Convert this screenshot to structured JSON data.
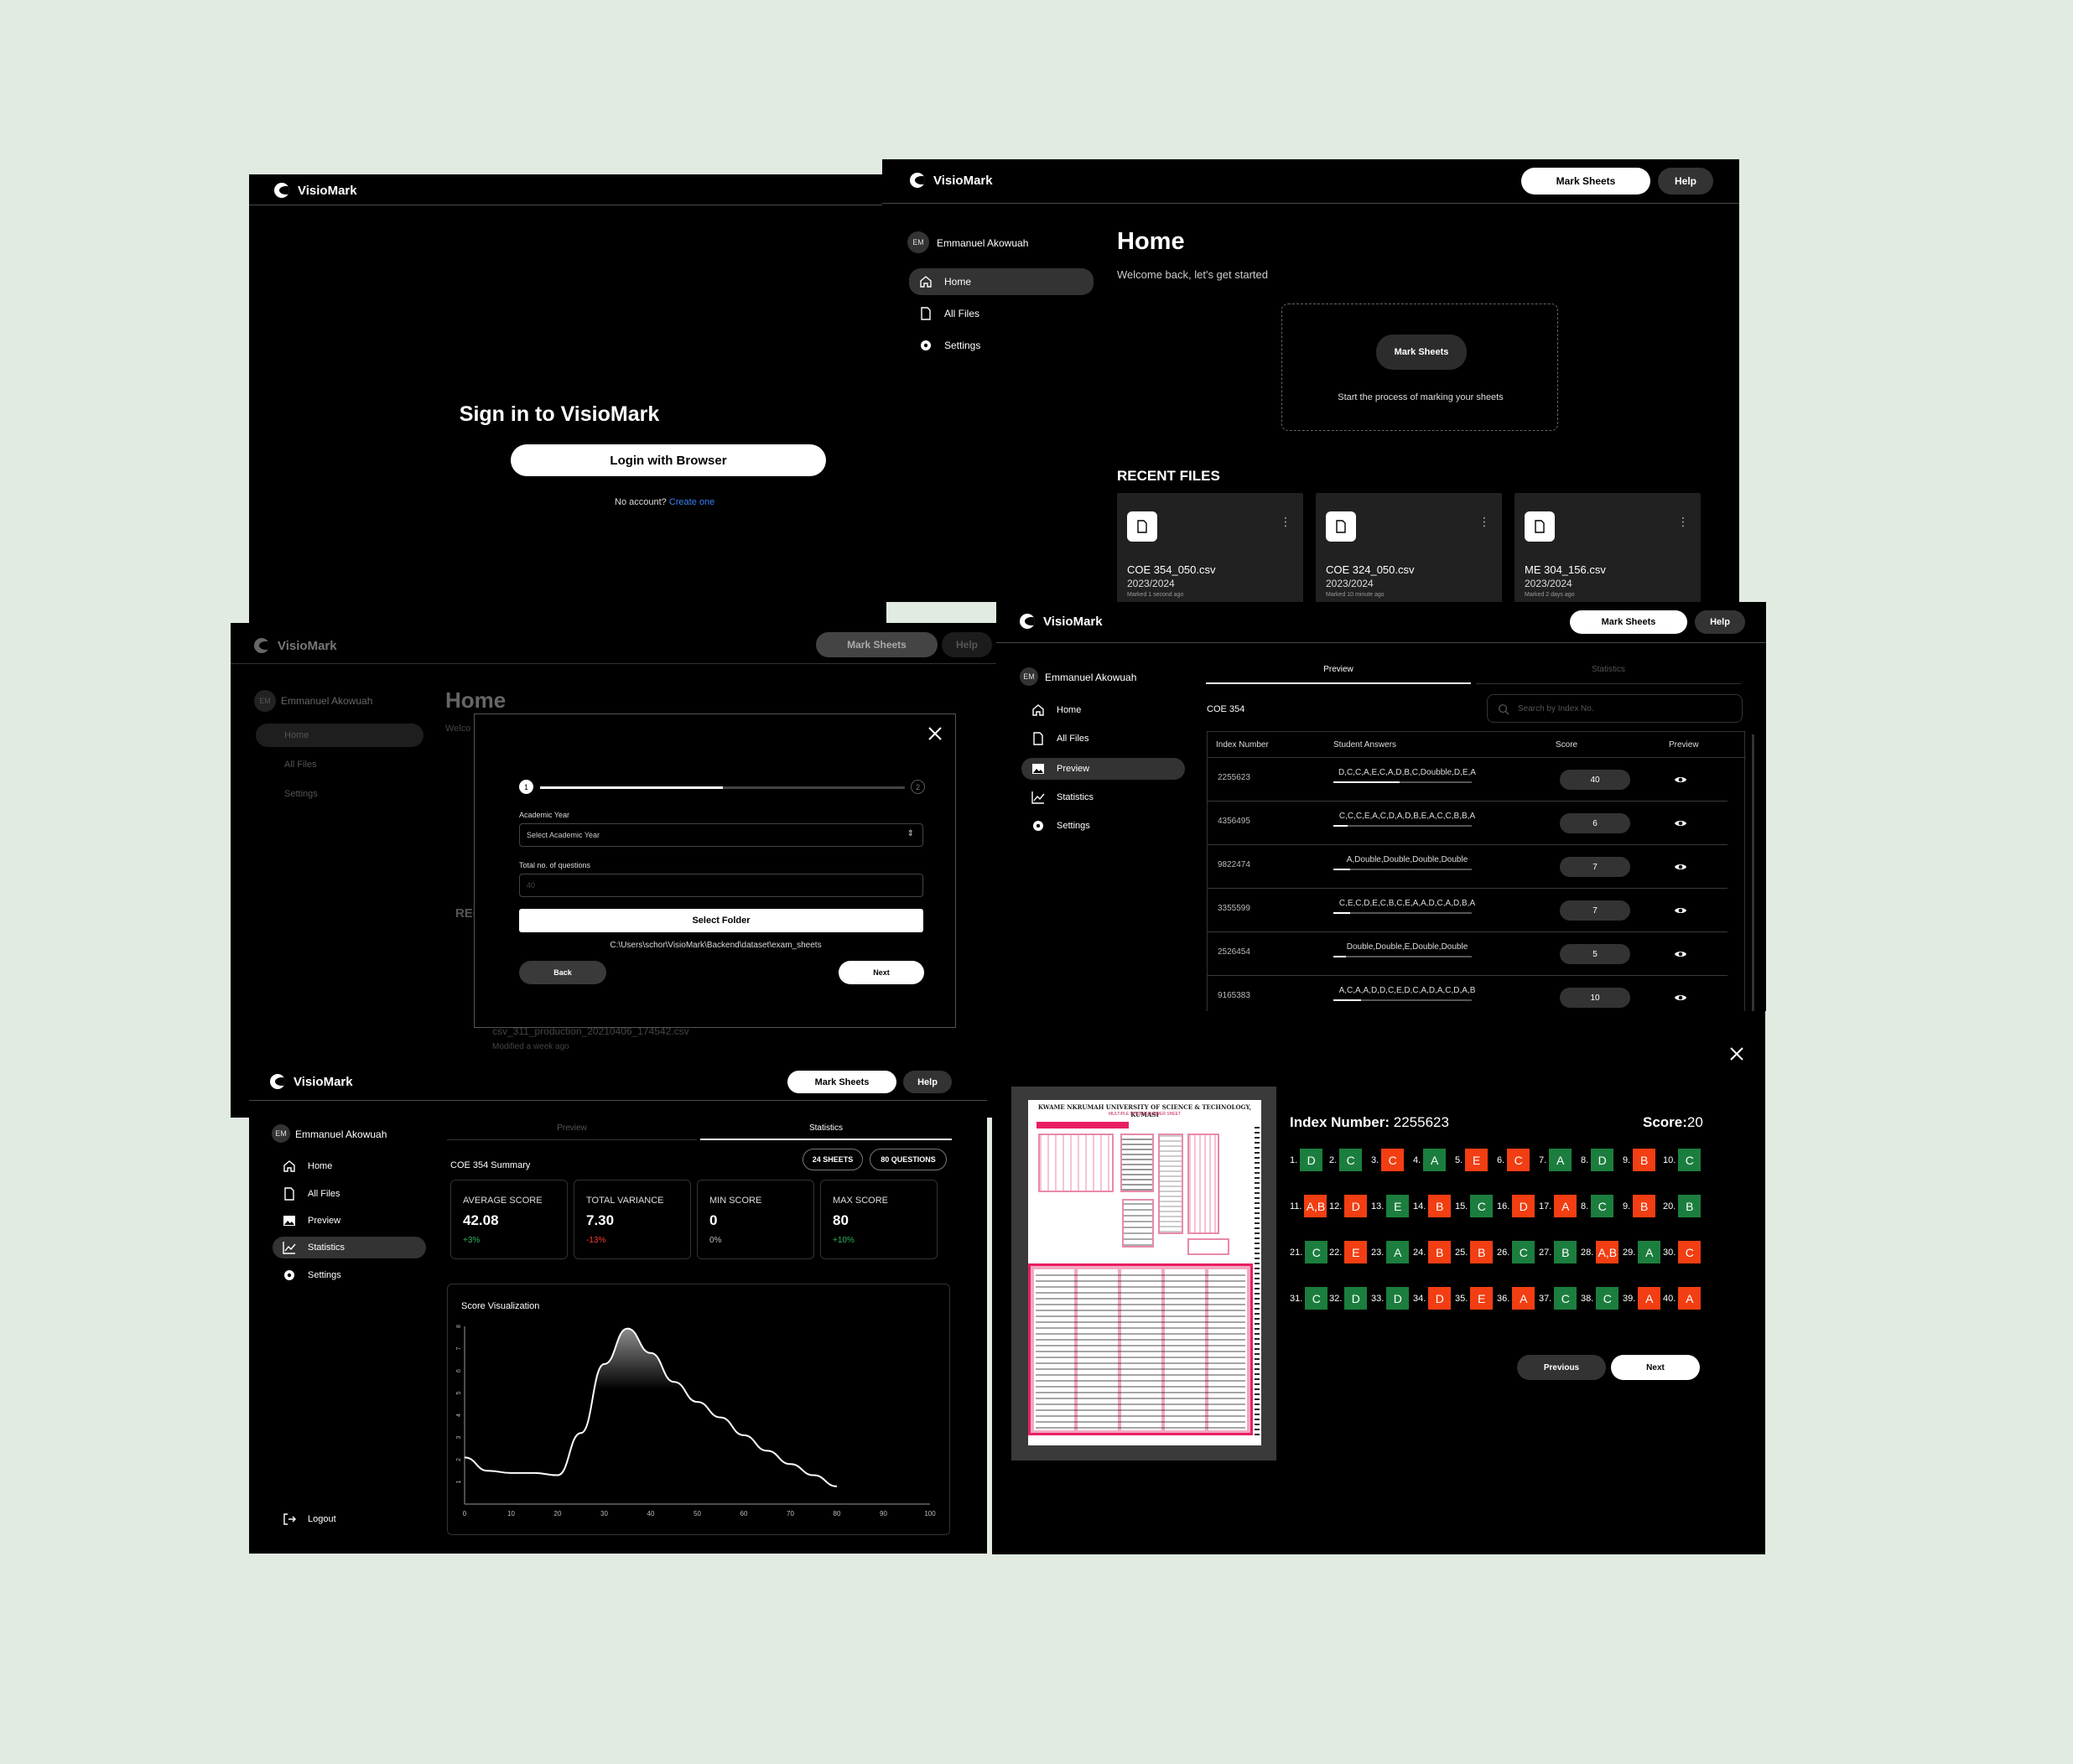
{
  "app": {
    "name": "VisioMark"
  },
  "user": {
    "initials": "EM",
    "name": "Emmanuel Akowuah"
  },
  "header": {
    "mark_sheets": "Mark Sheets",
    "help": "Help"
  },
  "nav": {
    "home": "Home",
    "all_files": "All Files",
    "settings": "Settings",
    "preview": "Preview",
    "statistics": "Statistics",
    "logout": "Logout"
  },
  "signin": {
    "title": "Sign in to VisioMark",
    "login_button": "Login with Browser",
    "no_account": "No account?",
    "create": "Create one"
  },
  "home": {
    "title": "Home",
    "subtitle": "Welcome back, let's get started",
    "cta_button": "Mark Sheets",
    "cta_text": "Start  the process of marking your sheets",
    "recent_heading": "RECENT FILES",
    "files": [
      {
        "name": "COE 354_050.csv",
        "year": "2023/2024",
        "meta": "Marked 1 second ago"
      },
      {
        "name": "COE 324_050.csv",
        "year": "2023/2024",
        "meta": "Marked 10 minute ago"
      },
      {
        "name": "ME 304_156.csv",
        "year": "2023/2024",
        "meta": "Marked 2 days ago"
      }
    ]
  },
  "modal_bg": {
    "title": "Home",
    "subtitle": "Welco",
    "recent": "REC",
    "file": "csv_311_production_20210406_174542.csv",
    "file_meta": "Modified a week ago"
  },
  "wizard": {
    "step1": "1",
    "step2": "2",
    "year_label": "Academic Year",
    "year_placeholder": "Select Academic Year",
    "questions_label": "Total no. of questions",
    "questions_placeholder": "40",
    "select_folder": "Select Folder",
    "path": "C:\\Users\\schor\\VisioMark\\Backend\\dataset\\exam_sheets",
    "back": "Back",
    "next": "Next"
  },
  "preview": {
    "tab_preview": "Preview",
    "tab_statistics": "Statistics",
    "course": "COE 354",
    "search_placeholder": "Search by Index No.",
    "columns": [
      "Index Number",
      "Student Answers",
      "Score",
      "Preview"
    ],
    "rows": [
      {
        "index": "2255623",
        "answers": "D,C,C,A,E,C,A,D,B,C,Doubble,D,E,A",
        "score": "40",
        "progress": 0.48
      },
      {
        "index": "4356495",
        "answers": "C,C,C,E,A,C,D,A,D,B,E,A,C,C,B,B,A",
        "score": "6",
        "progress": 0.1
      },
      {
        "index": "9822474",
        "answers": "A,Double,Double,Double,Double",
        "score": "7",
        "progress": 0.12
      },
      {
        "index": "3355599",
        "answers": "C,E,C,D,E,C,B,C,E,A,A,D,C,A,D,B,A",
        "score": "7",
        "progress": 0.12
      },
      {
        "index": "2526454",
        "answers": "Double,Double,E,Double,Double",
        "score": "5",
        "progress": 0.09
      },
      {
        "index": "9165383",
        "answers": "A,C,A,A,D,D,C,E,D,C,A,D,A,C,D,A,B",
        "score": "10",
        "progress": 0.2
      }
    ]
  },
  "stats": {
    "tab_preview": "Preview",
    "tab_statistics": "Statistics",
    "summary": "COE 354 Summary",
    "sheets": "24 SHEETS",
    "questions": "80 QUESTIONS",
    "cards": [
      {
        "title": "AVERAGE SCORE",
        "value": "42.08",
        "delta": "+3%",
        "color": "#2fb35a"
      },
      {
        "title": "TOTAL VARIANCE",
        "value": "7.30",
        "delta": "-13%",
        "color": "#ff3b2f"
      },
      {
        "title": "MIN SCORE",
        "value": "0",
        "delta": "0%",
        "color": "#bbbbbb"
      },
      {
        "title": "MAX SCORE",
        "value": "80",
        "delta": "+10%",
        "color": "#2fb35a"
      }
    ]
  },
  "chart_data": {
    "type": "line",
    "title": "Score Visualization",
    "x": [
      0,
      5,
      10,
      15,
      20,
      25,
      30,
      35,
      40,
      45,
      50,
      55,
      60,
      65,
      70,
      75,
      80
    ],
    "y": [
      2.1,
      1.5,
      1.4,
      1.4,
      1.3,
      3.2,
      6.3,
      7.9,
      6.8,
      5.5,
      4.6,
      3.9,
      3.1,
      2.4,
      1.8,
      1.3,
      0.8
    ],
    "xticks": [
      "0",
      "10",
      "20",
      "30",
      "40",
      "50",
      "60",
      "70",
      "80",
      "90",
      "100"
    ],
    "yticks": [
      "1",
      "2",
      "3",
      "4",
      "5",
      "6",
      "7",
      "8"
    ],
    "xlim": [
      0,
      100
    ],
    "ylim": [
      0,
      8
    ]
  },
  "detail": {
    "index_label": "Index Number:",
    "index": "2255623",
    "score_label": "Score:",
    "score": "20",
    "sheet_title": "KWAME NKRUMAH UNIVERSITY OF SCIENCE & TECHNOLOGY, KUMASI",
    "sheet_subtitle": "MULTIPLE CHOICE ANSWER SHEET",
    "previous": "Previous",
    "next": "Next",
    "answers": [
      [
        "1.",
        "D",
        "g"
      ],
      [
        "2.",
        "C",
        "g"
      ],
      [
        "3.",
        "C",
        "r"
      ],
      [
        "4.",
        "A",
        "g"
      ],
      [
        "5.",
        "E",
        "r"
      ],
      [
        "6.",
        "C",
        "r"
      ],
      [
        "7.",
        "A",
        "g"
      ],
      [
        "8.",
        "D",
        "g"
      ],
      [
        "9.",
        "B",
        "r"
      ],
      [
        "10.",
        "C",
        "g"
      ],
      [
        "11.",
        "A,B",
        "r"
      ],
      [
        "12.",
        "D",
        "r"
      ],
      [
        "13.",
        "E",
        "g"
      ],
      [
        "14.",
        "B",
        "r"
      ],
      [
        "15.",
        "C",
        "g"
      ],
      [
        "16.",
        "D",
        "r"
      ],
      [
        "17.",
        "A",
        "r"
      ],
      [
        "8.",
        "C",
        "g"
      ],
      [
        "9.",
        "B",
        "r"
      ],
      [
        "20.",
        "B",
        "g"
      ],
      [
        "21.",
        "C",
        "g"
      ],
      [
        "22.",
        "E",
        "r"
      ],
      [
        "23.",
        "A",
        "g"
      ],
      [
        "24.",
        "B",
        "r"
      ],
      [
        "25.",
        "B",
        "r"
      ],
      [
        "26.",
        "C",
        "g"
      ],
      [
        "27.",
        "B",
        "g"
      ],
      [
        "28.",
        "A,B",
        "r"
      ],
      [
        "29.",
        "A",
        "g"
      ],
      [
        "30.",
        "C",
        "r"
      ],
      [
        "31.",
        "C",
        "g"
      ],
      [
        "32.",
        "D",
        "g"
      ],
      [
        "33.",
        "D",
        "g"
      ],
      [
        "34.",
        "D",
        "r"
      ],
      [
        "35.",
        "E",
        "r"
      ],
      [
        "36.",
        "A",
        "r"
      ],
      [
        "37.",
        "C",
        "g"
      ],
      [
        "38.",
        "C",
        "g"
      ],
      [
        "39.",
        "A",
        "r"
      ],
      [
        "40.",
        "A",
        "r"
      ]
    ]
  }
}
